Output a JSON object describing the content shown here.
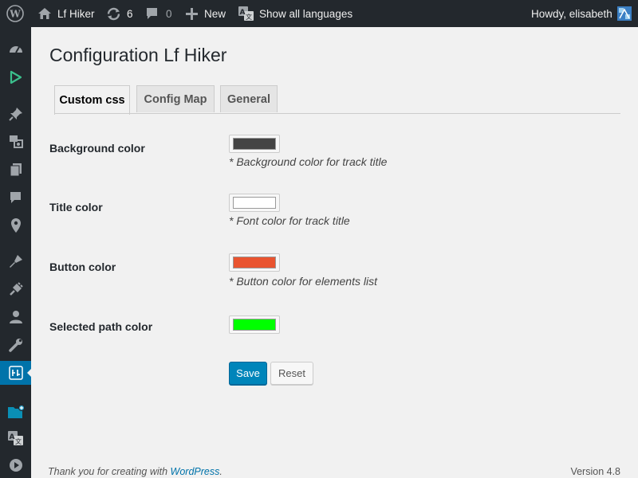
{
  "adminbar": {
    "site_name": "Lf Hiker",
    "updates_count": "6",
    "comments_count": "0",
    "new_label": "New",
    "languages_label": "Show all languages",
    "howdy": "Howdy, elisabeth"
  },
  "page": {
    "title": "Configuration Lf Hiker",
    "tabs": [
      {
        "label": "Custom css"
      },
      {
        "label": "Config Map"
      },
      {
        "label": "General"
      }
    ]
  },
  "fields": [
    {
      "label": "Background color",
      "value": "#444444",
      "description": "* Background color for track title"
    },
    {
      "label": "Title color",
      "value": "#ffffff",
      "description": "* Font color for track title"
    },
    {
      "label": "Button color",
      "value": "#e95430",
      "description": "* Button color for elements list"
    },
    {
      "label": "Selected path color",
      "value": "#00ff00",
      "description": ""
    }
  ],
  "buttons": {
    "save": "Save",
    "reset": "Reset"
  },
  "footer": {
    "thanks_prefix": "Thank you for creating with ",
    "link": "WordPress",
    "suffix": ".",
    "version": "Version 4.8"
  },
  "colors": {
    "adminbar_bg": "#23282d",
    "accent": "#0073aa",
    "primary_button": "#0085ba"
  }
}
